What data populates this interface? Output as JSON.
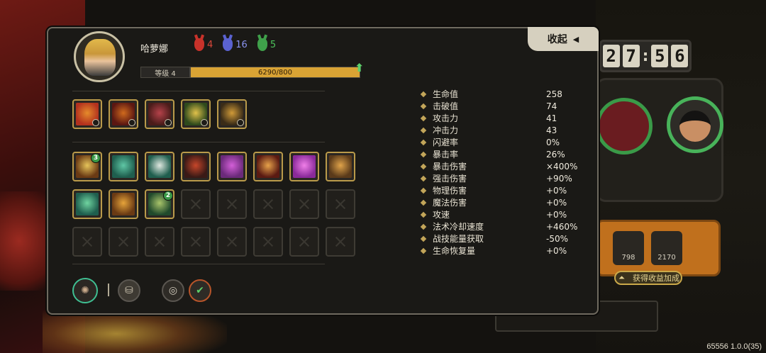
{
  "clock": {
    "d1": "2",
    "d2": "7",
    "d3": "5",
    "d4": "6"
  },
  "background": {
    "item1_value": "798",
    "item2_value": "2170",
    "bonus_label": "获得收益加成"
  },
  "version": "65556 1.0.0(35)",
  "panel": {
    "collapse_label": "收起",
    "hero_name": "哈萝娜",
    "hero_stats": [
      {
        "value": "4",
        "color": "#d9473a"
      },
      {
        "value": "16",
        "color": "#6f7ae0"
      },
      {
        "value": "5",
        "color": "#4cc25a"
      }
    ],
    "level_label": "等级 4",
    "xp_text": "6290/800",
    "xp_fraction": 1.0
  },
  "skills": {
    "row1": [
      {
        "color_a": "#b3311e",
        "color_b": "#e58b2b"
      },
      {
        "color_a": "#5b1712",
        "color_b": "#d06a1d"
      },
      {
        "color_a": "#4a1c1a",
        "color_b": "#b5424a"
      },
      {
        "color_a": "#2f4a1c",
        "color_b": "#e0c14a"
      },
      {
        "color_a": "#3a2c18",
        "color_b": "#d09a38"
      }
    ],
    "row2": [
      {
        "color_a": "#6a3a14",
        "color_b": "#e6c45a",
        "badge": "3"
      },
      {
        "color_a": "#1f5e4e",
        "color_b": "#5fc7a5"
      },
      {
        "color_a": "#1f5e4e",
        "color_b": "#dfe8e0"
      },
      {
        "color_a": "#3a1a16",
        "color_b": "#c7462a"
      },
      {
        "color_a": "#6b2a7a",
        "color_b": "#d35fd8"
      },
      {
        "color_a": "#5a1a12",
        "color_b": "#e7a24a"
      },
      {
        "color_a": "#8a2a9a",
        "color_b": "#f07fe8"
      },
      {
        "color_a": "#5a3a1a",
        "color_b": "#e0a34a"
      }
    ],
    "row3": [
      {
        "color_a": "#1f5e4e",
        "color_b": "#6fd4a0"
      },
      {
        "color_a": "#6a3a14",
        "color_b": "#e6a43a"
      },
      {
        "color_a": "#214a2c",
        "color_b": "#a9c46a",
        "badge": "2"
      }
    ]
  },
  "attributes": [
    {
      "name": "生命值",
      "value": "258"
    },
    {
      "name": "击破值",
      "value": "74"
    },
    {
      "name": "攻击力",
      "value": "41"
    },
    {
      "name": "冲击力",
      "value": "43"
    },
    {
      "name": "闪避率",
      "value": "0%"
    },
    {
      "name": "暴击率",
      "value": "26%"
    },
    {
      "name": "暴击伤害",
      "value": "×400%"
    },
    {
      "name": "强击伤害",
      "value": "+90%"
    },
    {
      "name": "物理伤害",
      "value": "+0%"
    },
    {
      "name": "魔法伤害",
      "value": "+0%"
    },
    {
      "name": "攻速",
      "value": "+0%"
    },
    {
      "name": "法术冷却速度",
      "value": "+460%"
    },
    {
      "name": "战技能量获取",
      "value": "-50%"
    },
    {
      "name": "生命恢复量",
      "value": "+0%"
    }
  ]
}
